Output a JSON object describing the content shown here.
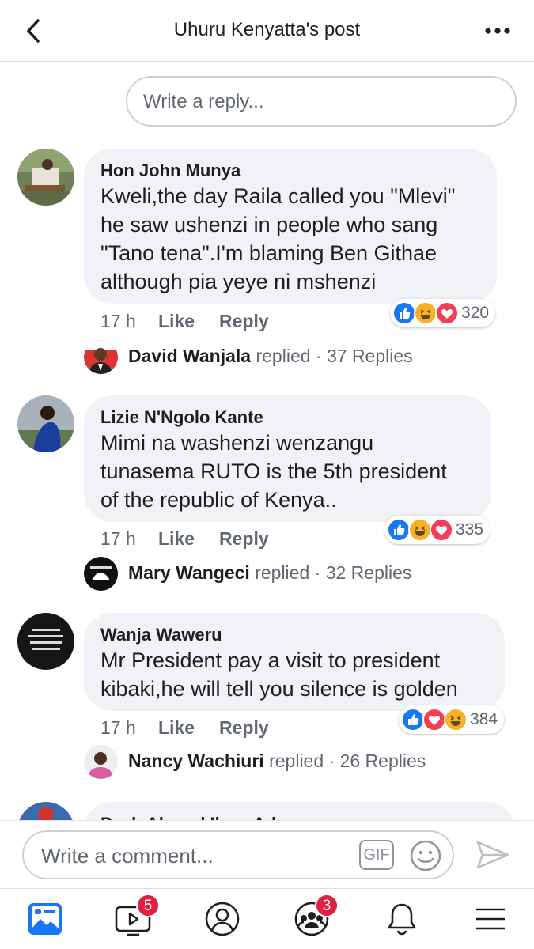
{
  "header": {
    "title": "Uhuru Kenyatta's post"
  },
  "reply_box": {
    "placeholder": "Write a reply..."
  },
  "comments": [
    {
      "author": "Hon John Munya",
      "text": "Kweli,the day Raila called you \"Mlevi\"\nhe saw ushenzi in people who sang\n\"Tano tena\".I'm blaming Ben Githae\nalthough pia yeye ni mshenzi",
      "time": "17 h",
      "like_label": "Like",
      "reply_label": "Reply",
      "reaction_icons": [
        "like-icon",
        "haha-icon",
        "love-icon"
      ],
      "reaction_count": "320",
      "reply_author": "David Wanjala",
      "reply_verb": "replied",
      "reply_count": "· 37 Replies"
    },
    {
      "author": "Lizie N'Ngolo Kante",
      "text": "Mimi na washenzi wenzangu\ntunasema RUTO is the 5th president\nof the republic of Kenya..",
      "time": "17 h",
      "like_label": "Like",
      "reply_label": "Reply",
      "reaction_icons": [
        "like-icon",
        "haha-icon",
        "love-icon"
      ],
      "reaction_count": "335",
      "reply_author": "Mary Wangeci",
      "reply_verb": "replied",
      "reply_count": "· 32 Replies"
    },
    {
      "author": "Wanja Waweru",
      "text": "Mr President pay a visit to president\nkibaki,he will tell you silence is golden",
      "time": "17 h",
      "like_label": "Like",
      "reply_label": "Reply",
      "reaction_icons": [
        "like-icon",
        "love-icon",
        "haha-icon"
      ],
      "reaction_count": "384",
      "reply_author": "Nancy Wachiuri",
      "reply_verb": "replied",
      "reply_count": "· 26 Replies"
    }
  ],
  "partial_comment": {
    "author": "Peah Ahmed Ilyas Adam"
  },
  "composer": {
    "placeholder": "Write a comment...",
    "gif_label": "GIF"
  },
  "bottom_nav": {
    "items": [
      "news-feed-icon",
      "watch-icon",
      "profile-icon",
      "groups-icon",
      "notifications-icon",
      "menu-icon"
    ],
    "watch_badge": "5",
    "groups_badge": "3"
  },
  "colors": {
    "like": "#1877f2",
    "love": "#f33e58",
    "haha": "#f7b125",
    "badge": "#e41e3f"
  }
}
